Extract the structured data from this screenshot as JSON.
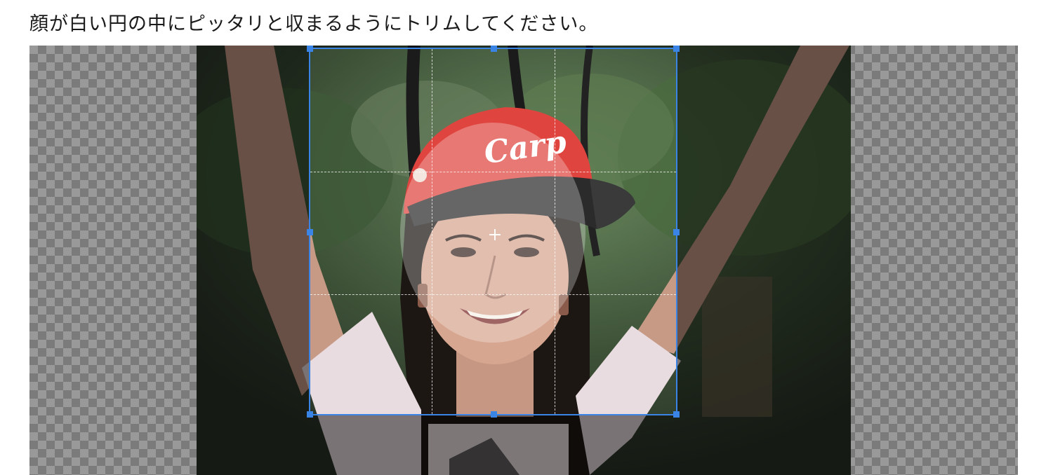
{
  "instruction": "顔が白い円の中にピッタリと収まるようにトリムしてください。",
  "photo": {
    "cap_logo_text": "Carp"
  },
  "colors": {
    "accent": "#3a84e6",
    "cap_red": "#e0443f",
    "checker_dark": "#7b7b7b",
    "checker_light": "#999999"
  },
  "icons": {
    "center": "crosshair-icon"
  }
}
